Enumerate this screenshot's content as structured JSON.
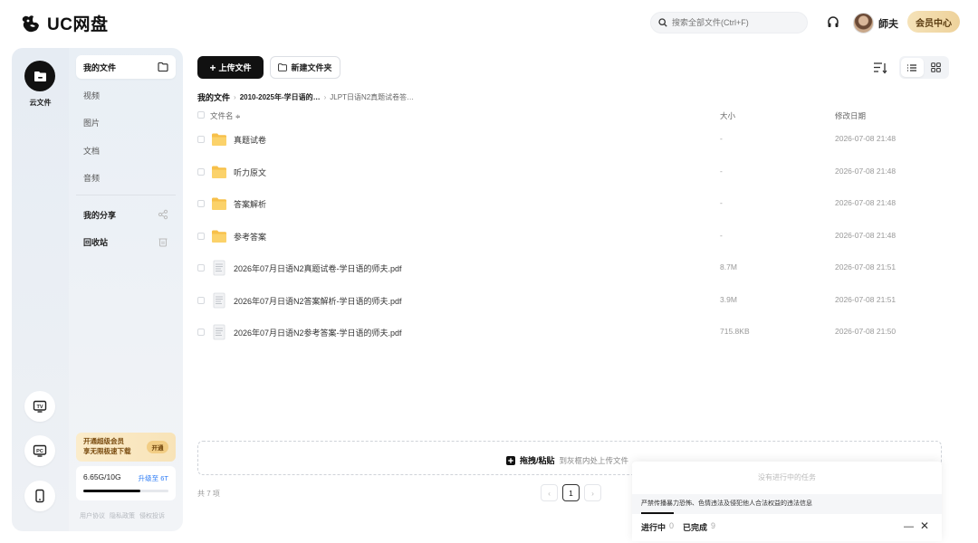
{
  "app": {
    "name": "UC网盘",
    "search_placeholder": "搜索全部文件(Ctrl+F)",
    "username": "師夫",
    "vip_button": "会员中心"
  },
  "rail": {
    "main_label": "云文件",
    "buttons": [
      "tv-icon",
      "pc-icon",
      "mobile-icon"
    ]
  },
  "sidebar": {
    "items": [
      {
        "label": "我的文件"
      },
      {
        "label": "视频"
      },
      {
        "label": "图片"
      },
      {
        "label": "文档"
      },
      {
        "label": "音频"
      },
      {
        "label": "我的分享"
      },
      {
        "label": "回收站"
      }
    ],
    "promo": {
      "line1": "开通超级会员",
      "line2": "享无限极速下载",
      "button": "开通"
    },
    "storage": {
      "used": "6.65G/10G",
      "upgrade": "升级至 6T",
      "fraction": 0.665
    },
    "footer_links": [
      "用户协议",
      "隐私政策",
      "侵权投诉"
    ]
  },
  "toolbar": {
    "upload_label": "上传文件",
    "new_folder_label": "新建文件夹"
  },
  "breadcrumb": {
    "root": "我的文件",
    "mid": "2010-2025年-学日语的…",
    "current": "JLPT日语N2真题试卷答…"
  },
  "columns": {
    "name": "文件名",
    "size": "大小",
    "date": "修改日期"
  },
  "files": [
    {
      "name": "真题试卷",
      "type": "folder",
      "size": "-",
      "date": "2026-07-08 21:48"
    },
    {
      "name": "听力原文",
      "type": "folder",
      "size": "-",
      "date": "2026-07-08 21:48"
    },
    {
      "name": "答案解析",
      "type": "folder",
      "size": "-",
      "date": "2026-07-08 21:48"
    },
    {
      "name": "参考答案",
      "type": "folder",
      "size": "-",
      "date": "2026-07-08 21:48"
    },
    {
      "name": "2026年07月日语N2真题试卷-学日语的师夫.pdf",
      "type": "pdf",
      "size": "8.7M",
      "date": "2026-07-08 21:51"
    },
    {
      "name": "2026年07月日语N2答案解析-学日语的师夫.pdf",
      "type": "pdf",
      "size": "3.9M",
      "date": "2026-07-08 21:51"
    },
    {
      "name": "2026年07月日语N2参考答案-学日语的师夫.pdf",
      "type": "pdf",
      "size": "715.8KB",
      "date": "2026-07-08 21:50"
    }
  ],
  "dropzone": {
    "main": "拖拽/粘贴",
    "sub": "到灰框内处上传文件"
  },
  "pagination": {
    "total": "共 7 项",
    "current_page": "1",
    "prev": "‹",
    "next": "›"
  },
  "transfer": {
    "empty": "没有进行中的任务",
    "notice": "严禁传播暴力恐怖、色情违法及侵犯他人合法权益的违法信息",
    "tab_active": "进行中",
    "tab_active_count": "0",
    "tab_done": "已完成",
    "tab_done_count": "9",
    "minimize": "—",
    "close": "✕"
  }
}
